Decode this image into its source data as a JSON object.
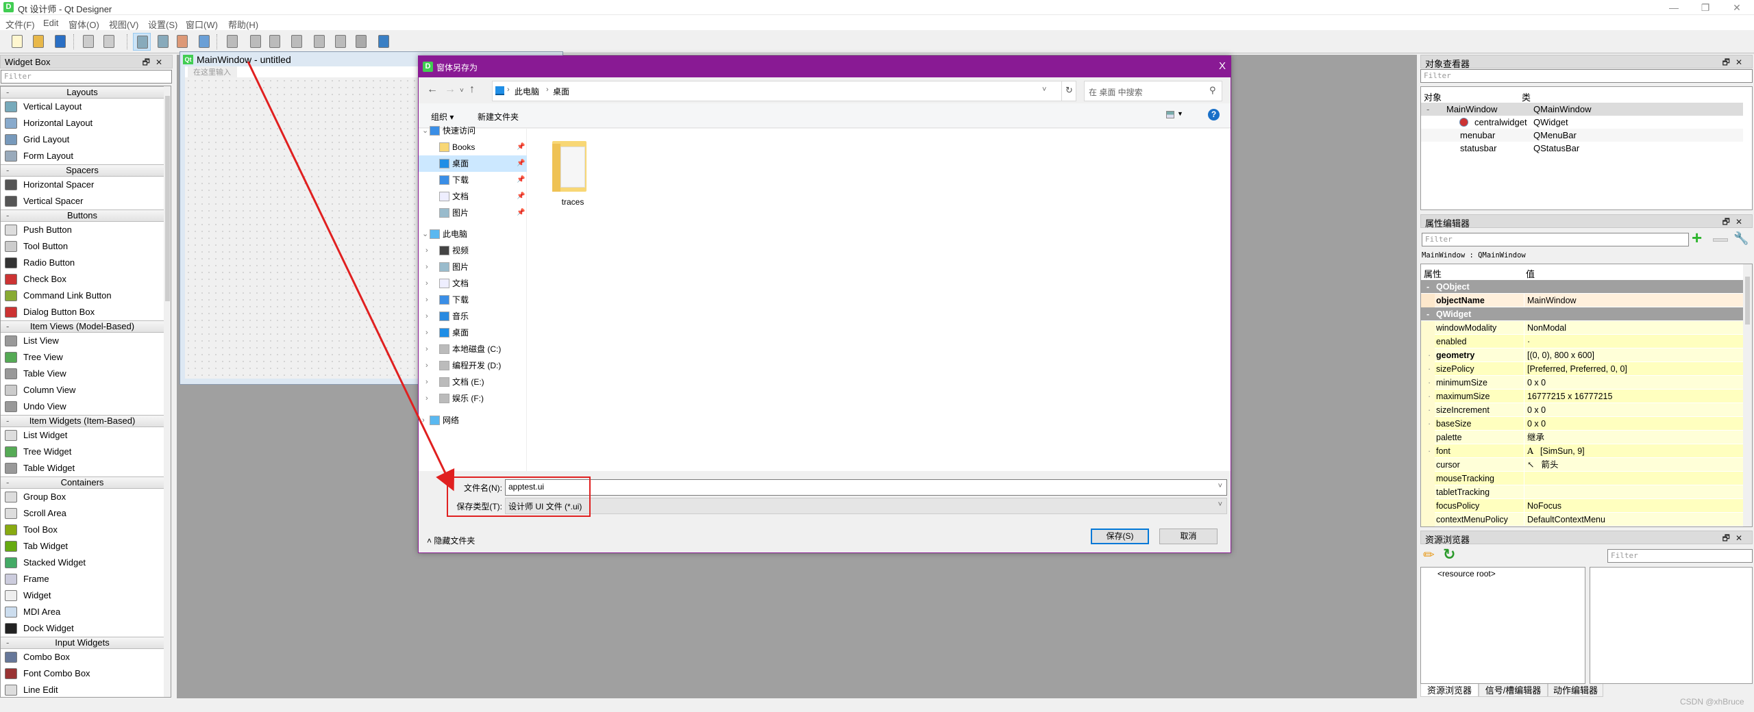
{
  "app": {
    "title": "Qt 设计师 - Qt Designer",
    "logo_letter": "D",
    "window_controls": [
      "minimize-icon",
      "restore-icon",
      "close-icon"
    ]
  },
  "menubar": [
    "文件(F)",
    "Edit",
    "窗体(O)",
    "视图(V)",
    "设置(S)",
    "窗口(W)",
    "帮助(H)"
  ],
  "toolbar": [
    {
      "icon": "new-file-icon"
    },
    {
      "icon": "open-folder-icon"
    },
    {
      "icon": "save-icon"
    },
    {
      "icon": "send-to-back-icon"
    },
    {
      "icon": "bring-to-front-icon"
    },
    {
      "icon": "edit-widgets-icon",
      "active": true
    },
    {
      "icon": "edit-signals-slots-icon"
    },
    {
      "icon": "edit-buddies-icon"
    },
    {
      "icon": "edit-tab-order-icon"
    },
    {
      "icon": "layout-horizontal-icon"
    },
    {
      "icon": "layout-vertical-icon"
    },
    {
      "icon": "layout-horizontal-splitter-icon"
    },
    {
      "icon": "layout-vertical-splitter-icon"
    },
    {
      "icon": "layout-grid-icon"
    },
    {
      "icon": "layout-form-icon"
    },
    {
      "icon": "break-layout-icon"
    },
    {
      "icon": "adjust-size-icon"
    }
  ],
  "widget_box": {
    "title": "Widget Box",
    "filter_placeholder": "Filter",
    "sections": [
      {
        "label": "Layouts",
        "items": [
          "Vertical Layout",
          "Horizontal Layout",
          "Grid Layout",
          "Form Layout"
        ]
      },
      {
        "label": "Spacers",
        "items": [
          "Horizontal Spacer",
          "Vertical Spacer"
        ]
      },
      {
        "label": "Buttons",
        "items": [
          "Push Button",
          "Tool Button",
          "Radio Button",
          "Check Box",
          "Command Link Button",
          "Dialog Button Box"
        ]
      },
      {
        "label": "Item Views (Model-Based)",
        "items": [
          "List View",
          "Tree View",
          "Table View",
          "Column View",
          "Undo View"
        ]
      },
      {
        "label": "Item Widgets (Item-Based)",
        "items": [
          "List Widget",
          "Tree Widget",
          "Table Widget"
        ]
      },
      {
        "label": "Containers",
        "items": [
          "Group Box",
          "Scroll Area",
          "Tool Box",
          "Tab Widget",
          "Stacked Widget",
          "Frame",
          "Widget",
          "MDI Area",
          "Dock Widget"
        ]
      },
      {
        "label": "Input Widgets",
        "items": [
          "Combo Box",
          "Font Combo Box",
          "Line Edit"
        ]
      }
    ]
  },
  "form": {
    "title": "MainWindow - untitled",
    "logo": "Qt",
    "menu_placeholder": "在这里输入"
  },
  "dialog": {
    "title": "窗体另存为",
    "breadcrumb": [
      "此电脑",
      "桌面"
    ],
    "search_placeholder": "在 桌面 中搜索",
    "organize": "组织 ▾",
    "new_folder": "新建文件夹",
    "nav": [
      {
        "label": "快速访问",
        "level": 0,
        "icon": "star-icon",
        "expanded": true
      },
      {
        "label": "Books",
        "level": 1,
        "icon": "folder-icon",
        "pinned": true
      },
      {
        "label": "桌面",
        "level": 1,
        "icon": "desktop-icon",
        "pinned": true,
        "selected": true
      },
      {
        "label": "下载",
        "level": 1,
        "icon": "download-icon",
        "pinned": true
      },
      {
        "label": "文档",
        "level": 1,
        "icon": "document-icon",
        "pinned": true
      },
      {
        "label": "图片",
        "level": 1,
        "icon": "picture-icon",
        "pinned": true
      },
      {
        "label": "此电脑",
        "level": 0,
        "icon": "computer-icon",
        "expanded": true
      },
      {
        "label": "视频",
        "level": 1,
        "icon": "video-icon",
        "collapsed": true
      },
      {
        "label": "图片",
        "level": 1,
        "icon": "picture-icon",
        "collapsed": true
      },
      {
        "label": "文档",
        "level": 1,
        "icon": "document-icon",
        "collapsed": true
      },
      {
        "label": "下载",
        "level": 1,
        "icon": "download-icon",
        "collapsed": true
      },
      {
        "label": "音乐",
        "level": 1,
        "icon": "music-icon",
        "collapsed": true
      },
      {
        "label": "桌面",
        "level": 1,
        "icon": "desktop-icon",
        "collapsed": true
      },
      {
        "label": "本地磁盘 (C:)",
        "level": 1,
        "icon": "system-drive-icon",
        "collapsed": true
      },
      {
        "label": "编程开发 (D:)",
        "level": 1,
        "icon": "drive-icon",
        "collapsed": true
      },
      {
        "label": "文档 (E:)",
        "level": 1,
        "icon": "drive-icon",
        "collapsed": true
      },
      {
        "label": "娱乐 (F:)",
        "level": 1,
        "icon": "drive-icon",
        "collapsed": true
      },
      {
        "label": "网络",
        "level": 0,
        "icon": "network-icon",
        "collapsed": true
      }
    ],
    "files": [
      {
        "name": "traces",
        "icon": "folder-icon"
      }
    ],
    "filename_label": "文件名(N):",
    "filename_value": "apptest.ui",
    "filetype_label": "保存类型(T):",
    "filetype_value": "设计师 UI 文件 (*.ui)",
    "hide_folders": "隐藏文件夹",
    "save": "保存(S)",
    "cancel": "取消",
    "close": "X"
  },
  "annotation": {
    "color": "#e02020"
  },
  "object_inspector": {
    "title": "对象查看器",
    "filter_placeholder": "Filter",
    "columns": [
      "对象",
      "类"
    ],
    "rows": [
      {
        "object": "MainWindow",
        "class": "QMainWindow",
        "level": 0,
        "selected": true
      },
      {
        "object": "centralwidget",
        "class": "QWidget",
        "level": 1,
        "icon": "layout-broken-icon"
      },
      {
        "object": "menubar",
        "class": "QMenuBar",
        "level": 1
      },
      {
        "object": "statusbar",
        "class": "QStatusBar",
        "level": 1
      }
    ]
  },
  "property_editor": {
    "title": "属性编辑器",
    "filter_placeholder": "Filter",
    "context": "MainWindow : QMainWindow",
    "columns": [
      "属性",
      "值"
    ],
    "rows": [
      {
        "group": "QObject"
      },
      {
        "name": "objectName",
        "value": "MainWindow",
        "bold": true,
        "highlight": true
      },
      {
        "group": "QWidget"
      },
      {
        "name": "windowModality",
        "value": "NonModal"
      },
      {
        "name": "enabled",
        "value": "·"
      },
      {
        "name": "geometry",
        "value": "[(0, 0), 800 x 600]",
        "bold": true,
        "expandable": true
      },
      {
        "name": "sizePolicy",
        "value": "[Preferred, Preferred, 0, 0]",
        "expandable": true
      },
      {
        "name": "minimumSize",
        "value": "0 x 0",
        "expandable": true
      },
      {
        "name": "maximumSize",
        "value": "16777215 x 16777215",
        "expandable": true
      },
      {
        "name": "sizeIncrement",
        "value": "0 x 0",
        "expandable": true
      },
      {
        "name": "baseSize",
        "value": "0 x 0",
        "expandable": true
      },
      {
        "name": "palette",
        "value": "继承"
      },
      {
        "name": "font",
        "value": "[SimSun, 9]",
        "prefix": "A",
        "expandable": true
      },
      {
        "name": "cursor",
        "value": "箭头",
        "prefix": "↖"
      },
      {
        "name": "mouseTracking",
        "value": ""
      },
      {
        "name": "tabletTracking",
        "value": ""
      },
      {
        "name": "focusPolicy",
        "value": "NoFocus"
      },
      {
        "name": "contextMenuPolicy",
        "value": "DefaultContextMenu"
      }
    ]
  },
  "resource_browser": {
    "title": "资源浏览器",
    "filter_placeholder": "Filter",
    "root": "<resource root>",
    "tabs": [
      "资源浏览器",
      "信号/槽编辑器",
      "动作编辑器"
    ],
    "active_tab": 0
  },
  "watermark": "CSDN @xhBruce"
}
